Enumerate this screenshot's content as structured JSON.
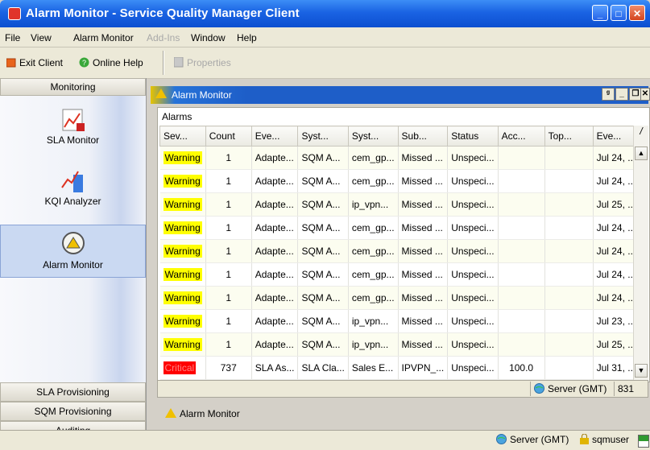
{
  "window": {
    "title": "Alarm Monitor - Service Quality Manager Client"
  },
  "menu": [
    {
      "label": "File",
      "enabled": true
    },
    {
      "label": "View",
      "enabled": true
    },
    {
      "label": "Alarm Monitor",
      "enabled": true
    },
    {
      "label": "Add-Ins",
      "enabled": false
    },
    {
      "label": "Window",
      "enabled": true
    },
    {
      "label": "Help",
      "enabled": true
    }
  ],
  "toolbar": {
    "exit_label": "Exit Client",
    "help_label": "Online Help",
    "properties_label": "Properties"
  },
  "sidebar": {
    "header": "Monitoring",
    "items": [
      {
        "label": "SLA Monitor",
        "icon": "sla-monitor-icon"
      },
      {
        "label": "KQI Analyzer",
        "icon": "kqi-analyzer-icon"
      },
      {
        "label": "Alarm Monitor",
        "icon": "alarm-monitor-icon",
        "selected": true
      }
    ],
    "bottom_tabs": [
      "SLA Provisioning",
      "SQM Provisioning",
      "Auditing"
    ]
  },
  "panel": {
    "title": "Alarm Monitor",
    "group_label": "Alarms"
  },
  "table": {
    "columns": [
      "Sev...",
      "Count",
      "Eve...",
      "Syst...",
      "Syst...",
      "Sub...",
      "Status",
      "Acc...",
      "Top...",
      "Eve..."
    ],
    "rows": [
      {
        "sev": "Warning",
        "level": "warning",
        "count": "1",
        "event_type": "Adapte...",
        "system1": "SQM A...",
        "system2": "cem_gp...",
        "sub": "Missed ...",
        "status": "Unspeci...",
        "acc": "",
        "top": "",
        "event_time": "Jul 24, ..."
      },
      {
        "sev": "Warning",
        "level": "warning",
        "count": "1",
        "event_type": "Adapte...",
        "system1": "SQM A...",
        "system2": "cem_gp...",
        "sub": "Missed ...",
        "status": "Unspeci...",
        "acc": "",
        "top": "",
        "event_time": "Jul 24, ..."
      },
      {
        "sev": "Warning",
        "level": "warning",
        "count": "1",
        "event_type": "Adapte...",
        "system1": "SQM A...",
        "system2": "ip_vpn...",
        "sub": "Missed ...",
        "status": "Unspeci...",
        "acc": "",
        "top": "",
        "event_time": "Jul 25, ..."
      },
      {
        "sev": "Warning",
        "level": "warning",
        "count": "1",
        "event_type": "Adapte...",
        "system1": "SQM A...",
        "system2": "cem_gp...",
        "sub": "Missed ...",
        "status": "Unspeci...",
        "acc": "",
        "top": "",
        "event_time": "Jul 24, ..."
      },
      {
        "sev": "Warning",
        "level": "warning",
        "count": "1",
        "event_type": "Adapte...",
        "system1": "SQM A...",
        "system2": "cem_gp...",
        "sub": "Missed ...",
        "status": "Unspeci...",
        "acc": "",
        "top": "",
        "event_time": "Jul 24, ..."
      },
      {
        "sev": "Warning",
        "level": "warning",
        "count": "1",
        "event_type": "Adapte...",
        "system1": "SQM A...",
        "system2": "cem_gp...",
        "sub": "Missed ...",
        "status": "Unspeci...",
        "acc": "",
        "top": "",
        "event_time": "Jul 24, ..."
      },
      {
        "sev": "Warning",
        "level": "warning",
        "count": "1",
        "event_type": "Adapte...",
        "system1": "SQM A...",
        "system2": "cem_gp...",
        "sub": "Missed ...",
        "status": "Unspeci...",
        "acc": "",
        "top": "",
        "event_time": "Jul 24, ..."
      },
      {
        "sev": "Warning",
        "level": "warning",
        "count": "1",
        "event_type": "Adapte...",
        "system1": "SQM A...",
        "system2": "ip_vpn...",
        "sub": "Missed ...",
        "status": "Unspeci...",
        "acc": "",
        "top": "",
        "event_time": "Jul 23, ..."
      },
      {
        "sev": "Warning",
        "level": "warning",
        "count": "1",
        "event_type": "Adapte...",
        "system1": "SQM A...",
        "system2": "ip_vpn...",
        "sub": "Missed ...",
        "status": "Unspeci...",
        "acc": "",
        "top": "",
        "event_time": "Jul 25, ..."
      },
      {
        "sev": "Critical",
        "level": "critical",
        "count": "737",
        "event_type": "SLA As...",
        "system1": "SLA Cla...",
        "system2": "Sales E...",
        "sub": "IPVPN_...",
        "status": "Unspeci...",
        "acc": "100.0",
        "top": "",
        "event_time": "Jul 31, ..."
      }
    ]
  },
  "panel_status": {
    "server": "Server (GMT)",
    "count": "831"
  },
  "doc_tab": {
    "label": "Alarm Monitor"
  },
  "statusbar": {
    "server": "Server (GMT)",
    "user": "sqmuser"
  },
  "colors": {
    "warning": "#ffff00",
    "critical": "#ff0000",
    "title_blue": "#1a63e3"
  }
}
